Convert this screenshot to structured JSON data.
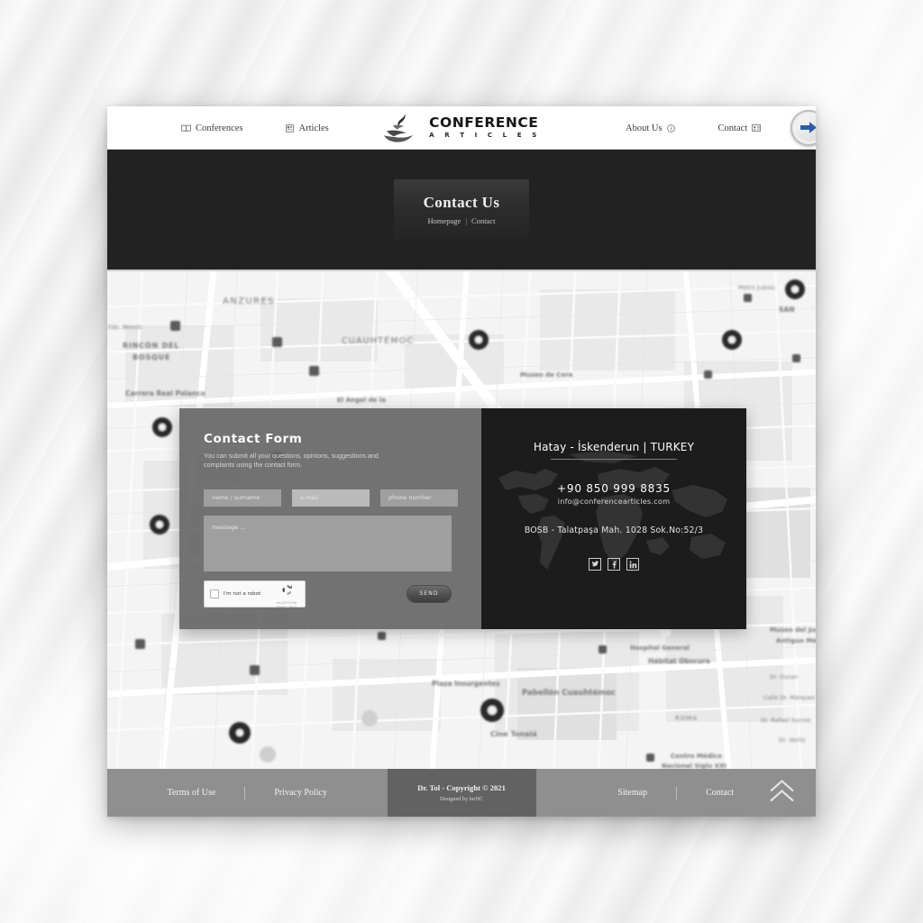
{
  "header": {
    "nav_left": [
      {
        "label": "Conferences",
        "icon": "book-icon"
      },
      {
        "label": "Articles",
        "icon": "newspaper-icon"
      }
    ],
    "nav_right": [
      {
        "label": "About Us",
        "icon": "info-icon"
      },
      {
        "label": "Contact",
        "icon": "contact-card-icon"
      }
    ],
    "logo": {
      "main": "CONFERENCE",
      "sub": "A R T I C L E S",
      "mark": "flame-wave-logo-icon"
    },
    "login_button": {
      "icon": "arrow-right-icon",
      "color": "#2a5caa"
    }
  },
  "banner": {
    "title": "Contact Us",
    "breadcrumb": {
      "home": "Homepage",
      "separator": "|",
      "current": "Contact"
    },
    "background_color": "#222222"
  },
  "map": {
    "style": "grayscale-street-map",
    "city": "Mexico City",
    "labels": [
      "ANZURES",
      "RINCÓN DEL BOSQUE",
      "CUAUHTÉMOC",
      "Carrera Real Polanco",
      "Museo de Cera",
      "El Ángel de la",
      "Plaza Insurgentes",
      "Pabellón Cuauhtémoc",
      "Cine Tonalá",
      "Hospital General",
      "Hábitat Obscura",
      "Centro Médico Nacional Siglo XXI",
      "ROMA",
      "Museo del Juguete Antiguo México",
      "Calle Dr. Márquez",
      "Dr. Rafael Sucrez"
    ]
  },
  "contact_form": {
    "title": "Contact Form",
    "description": "You can submit all your questions, opinions, suggestions and complaints using the contact form.",
    "fields": [
      {
        "name": "name-surname",
        "placeholder": "name / surname",
        "value": ""
      },
      {
        "name": "email",
        "placeholder": "e-mail",
        "value": ""
      },
      {
        "name": "phone",
        "placeholder": "phone number",
        "value": ""
      }
    ],
    "message": {
      "placeholder": "message ...",
      "value": ""
    },
    "recaptcha": {
      "label": "I'm not a robot",
      "brand": "reCAPTCHA",
      "legal": "Privacy - Terms",
      "checked": false
    },
    "send_label": "SEND"
  },
  "contact_info": {
    "location": "Hatay - İskenderun | TURKEY",
    "phone": "+90 850 999 8835",
    "email": "info@conferencearticles.com",
    "address": "BOSB - Talatpaşa Mah. 1028 Sok.No:52/3",
    "socials": [
      {
        "name": "twitter",
        "glyph": "twitter-icon"
      },
      {
        "name": "facebook",
        "glyph": "facebook-icon"
      },
      {
        "name": "linkedin",
        "glyph": "linkedin-icon"
      }
    ],
    "background_color": "#1c1c1c"
  },
  "footer": {
    "left_links": [
      "Terms of Use",
      "Privacy Policy"
    ],
    "right_links": [
      "Sitemap",
      "Contact"
    ],
    "copyright": "Dr. Tol - Copyright © 2021",
    "designer": "Designed by bırNC",
    "to_top_icon": "double-chevron-up-icon",
    "background_color": "#8f8f8f",
    "center_background_color": "#626262"
  }
}
